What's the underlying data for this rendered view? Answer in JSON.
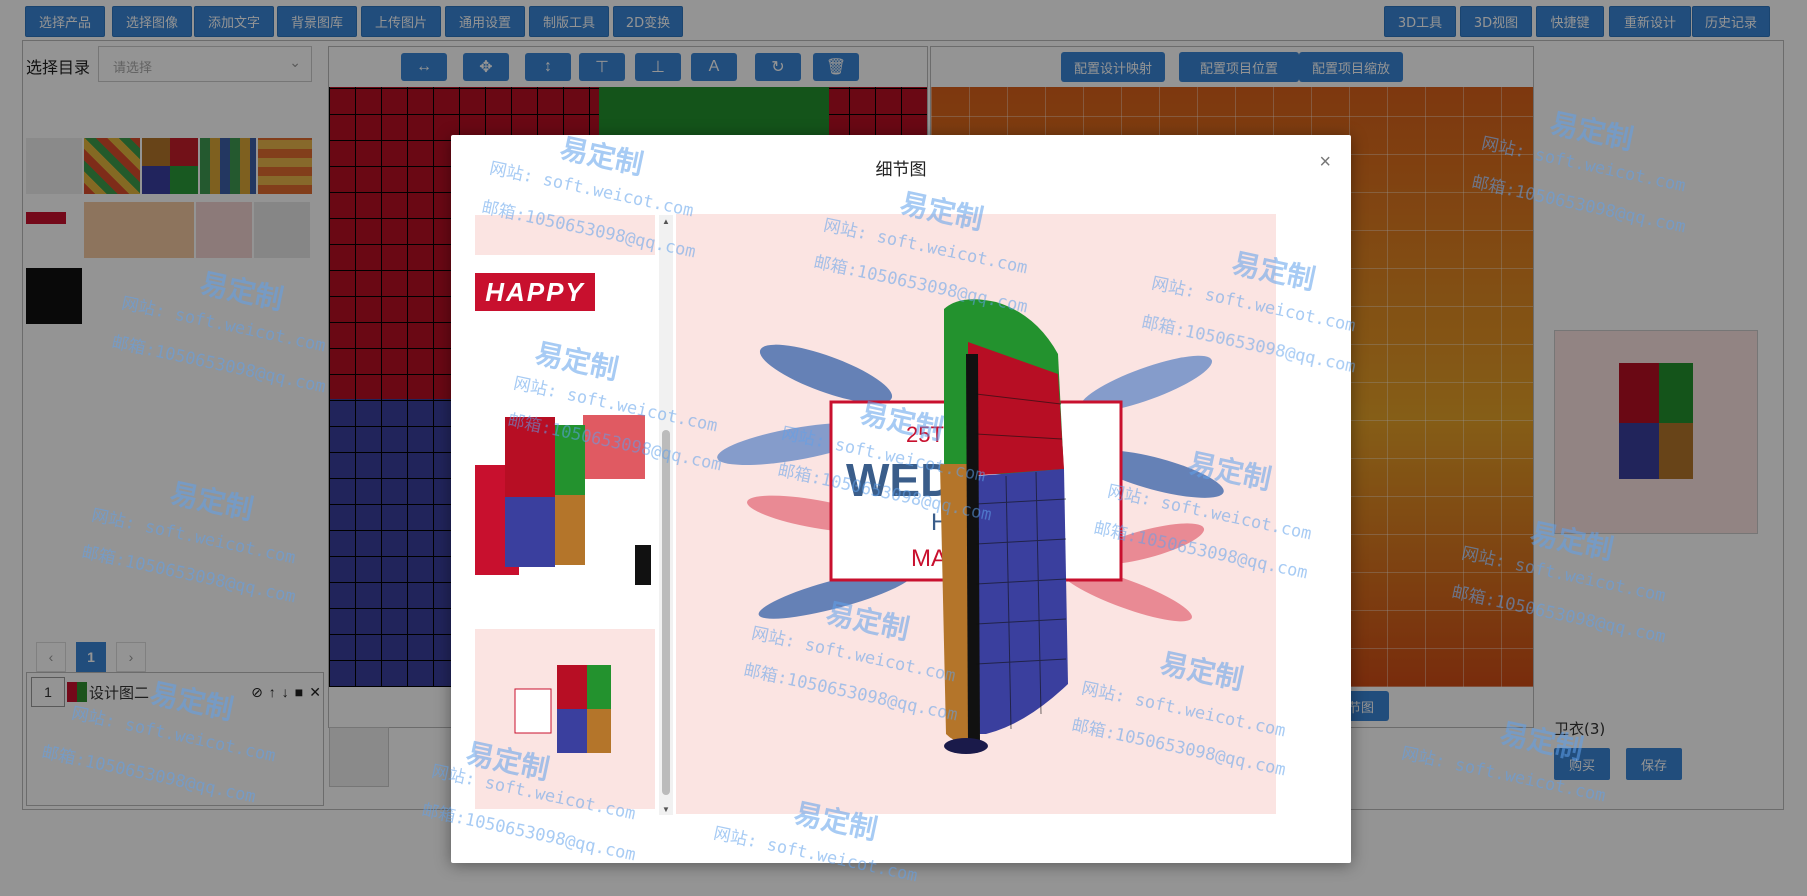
{
  "toolbar_left": [
    "选择产品",
    "选择图像",
    "添加文字",
    "背景图库",
    "上传图片",
    "通用设置",
    "制版工具",
    "2D变换"
  ],
  "toolbar_right": [
    "3D工具",
    "3D视图",
    "快捷键",
    "重新设计",
    "历史记录"
  ],
  "left_panel": {
    "dir_label": "选择目录",
    "dir_placeholder": "请选择",
    "page": "1",
    "layer": {
      "index": "1",
      "name": "设计图二"
    }
  },
  "config_buttons": [
    "配置设计映射",
    "配置项目位置",
    "配置项目缩放"
  ],
  "hidden_button": "节图",
  "right_panel": {
    "product": "卫衣(3)",
    "buy": "购买",
    "save": "保存"
  },
  "modal": {
    "title": "细节图",
    "close": "×",
    "strip_happy": "HAPPY",
    "main_art": {
      "line1": "25TH",
      "line2": "WED",
      "line3": "HA",
      "line4": "MA"
    }
  },
  "watermark": {
    "brand": "易定制",
    "site": "网站: soft.weicot.com",
    "mail": "邮箱:1050653098@qq.com"
  },
  "colors": {
    "accent": "#3a86d6",
    "red": "#b70e24",
    "green": "#23922e",
    "blue": "#3a3f9e",
    "gold": "#b4752a",
    "pink_bg": "#fbe4e2"
  }
}
